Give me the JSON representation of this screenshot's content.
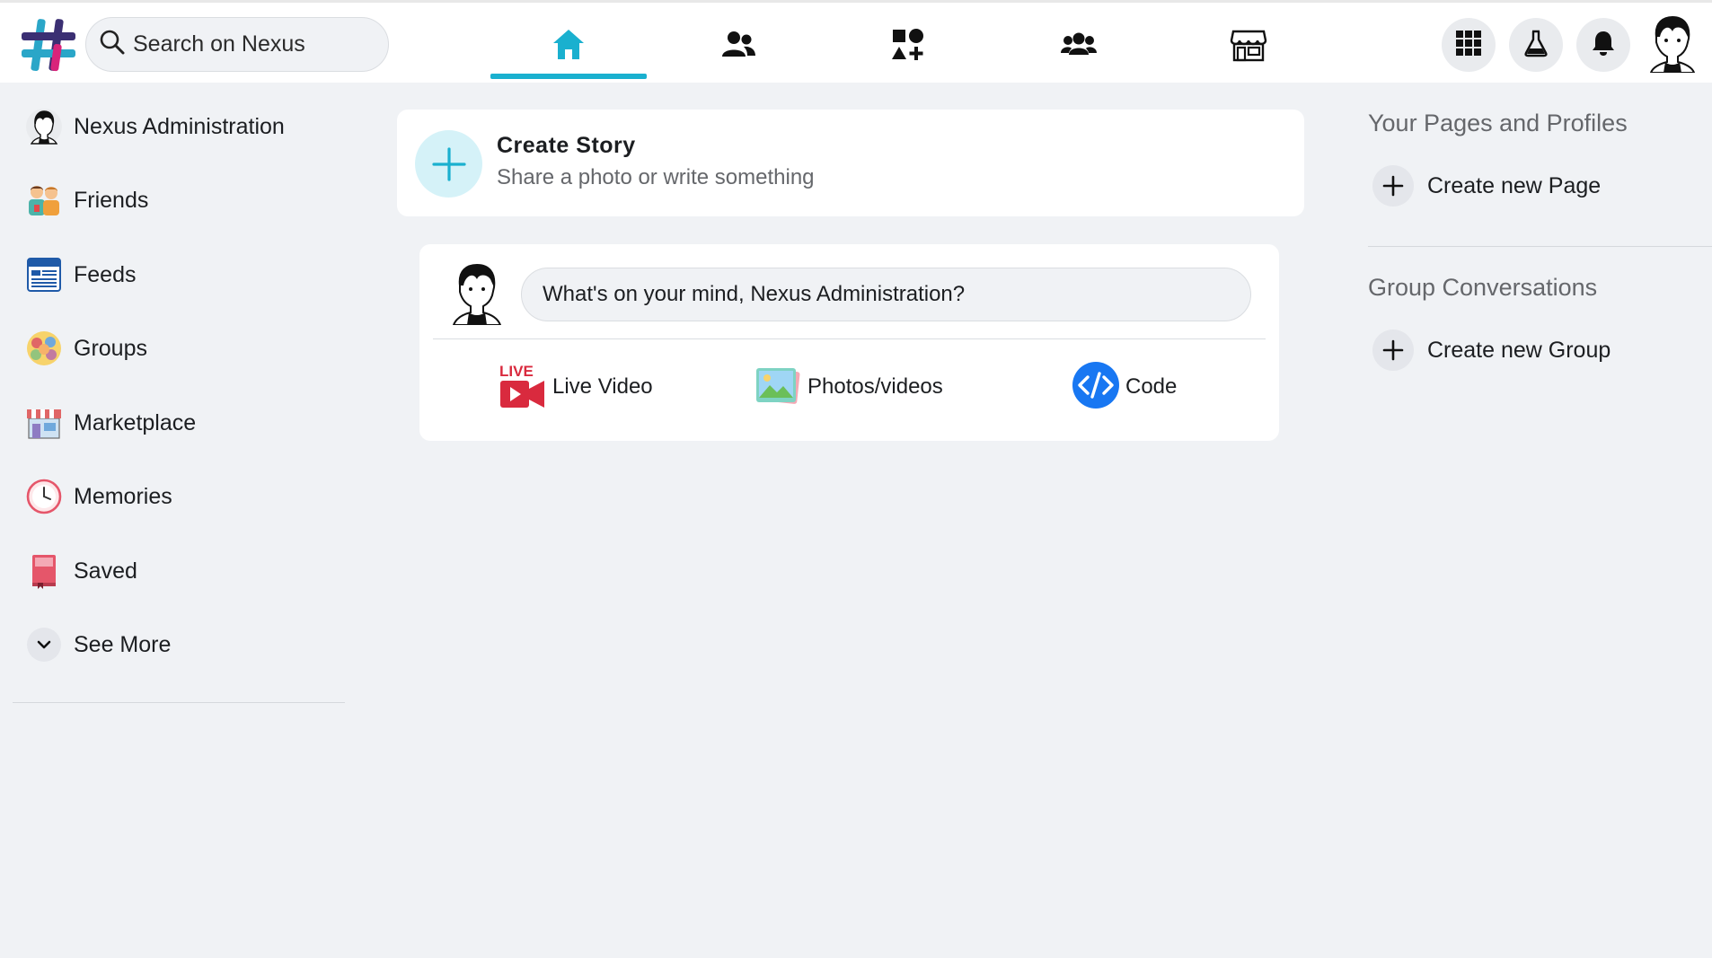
{
  "header": {
    "logo": "nexus-logo",
    "search": {
      "placeholder": "Search on Nexus",
      "icon": "search-icon"
    },
    "tabs": [
      {
        "name": "home",
        "icon": "home-icon",
        "active": true
      },
      {
        "name": "friends",
        "icon": "friends-icon",
        "active": false
      },
      {
        "name": "apps",
        "icon": "apps-add-icon",
        "active": false
      },
      {
        "name": "groups",
        "icon": "groups-icon",
        "active": false
      },
      {
        "name": "marketplace",
        "icon": "store-icon",
        "active": false
      }
    ],
    "actions": [
      {
        "name": "menu",
        "icon": "grid-menu-icon"
      },
      {
        "name": "lab",
        "icon": "flask-icon"
      },
      {
        "name": "notifications",
        "icon": "bell-icon"
      }
    ],
    "accent_color": "#1ab0cf"
  },
  "sidebar": {
    "items": [
      {
        "label": "Nexus Administration",
        "icon": "user-avatar"
      },
      {
        "label": "Friends",
        "icon": "friends-icon"
      },
      {
        "label": "Feeds",
        "icon": "feeds-icon"
      },
      {
        "label": "Groups",
        "icon": "groups-icon"
      },
      {
        "label": "Marketplace",
        "icon": "marketplace-icon"
      },
      {
        "label": "Memories",
        "icon": "clock-icon"
      },
      {
        "label": "Saved",
        "icon": "bookmark-icon"
      },
      {
        "label": "See More",
        "icon": "chevron-down-icon"
      }
    ]
  },
  "story": {
    "title": "Create Story",
    "subtitle": "Share a photo or write something"
  },
  "composer": {
    "placeholder": "What's on your mind, Nexus Administration?",
    "actions": [
      {
        "label": "Live Video",
        "icon": "live-video-icon"
      },
      {
        "label": "Photos/videos",
        "icon": "photo-icon"
      },
      {
        "label": "Code",
        "icon": "code-icon"
      }
    ]
  },
  "right": {
    "pages_heading": "Your Pages and Profiles",
    "create_page": "Create new Page",
    "groups_heading": "Group Conversations",
    "create_group": "Create new Group"
  }
}
